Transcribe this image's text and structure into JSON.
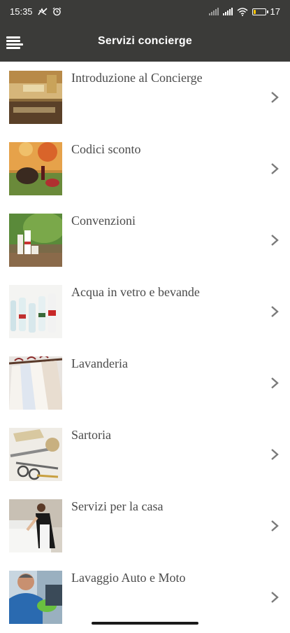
{
  "status": {
    "time": "15:35",
    "battery_pct": "17",
    "battery_level": 0.17,
    "battery_color": "#f5c400"
  },
  "appbar": {
    "title": "Servizi concierge",
    "menu_icon": "hamburger-menu-icon"
  },
  "items": [
    {
      "label": "Introduzione al Concierge",
      "image": "concierge-desk-photo"
    },
    {
      "label": "Codici sconto",
      "image": "autumn-wine-picnic-photo"
    },
    {
      "label": "Convenzioni",
      "image": "cosmetics-bottles-photo"
    },
    {
      "label": "Acqua in vetro e bevande",
      "image": "glass-bottles-photo"
    },
    {
      "label": "Lavanderia",
      "image": "shirts-on-hangers-photo"
    },
    {
      "label": "Sartoria",
      "image": "tailoring-tools-photo"
    },
    {
      "label": "Servizi per la casa",
      "image": "housekeeper-bed-photo"
    },
    {
      "label": "Lavaggio Auto e Moto",
      "image": "car-wash-man-photo"
    }
  ],
  "colors": {
    "bar_bg": "#3b3b39",
    "label_text": "#4a4a4a",
    "chevron": "#7a7a7a"
  }
}
